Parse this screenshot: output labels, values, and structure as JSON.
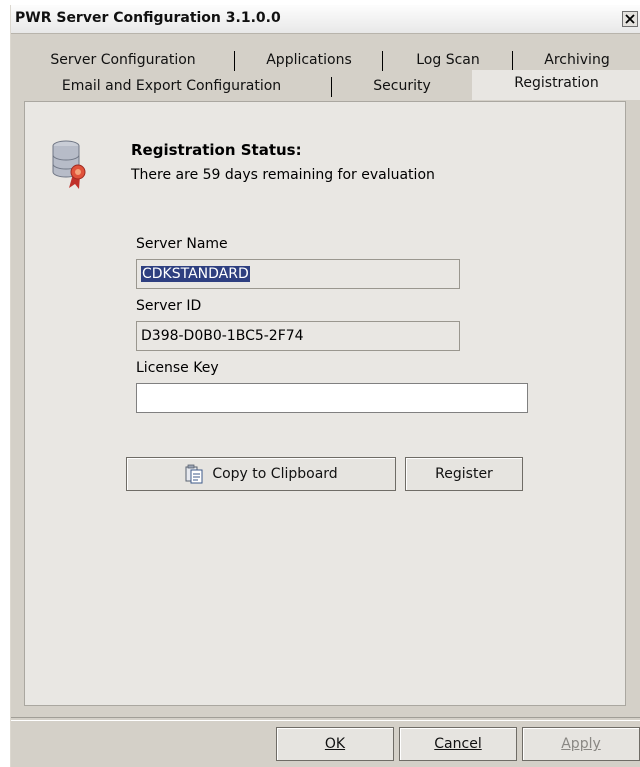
{
  "window": {
    "title": "PWR Server Configuration 3.1.0.0",
    "close_label": "X"
  },
  "tabs": {
    "row1": [
      "Server Configuration",
      "Applications",
      "Log Scan",
      "Archiving"
    ],
    "row2": [
      "Email and Export Configuration",
      "Security",
      "Registration"
    ],
    "active": "Registration"
  },
  "registration": {
    "status_title": "Registration Status:",
    "status_text": "There are 59 days remaining for evaluation",
    "server_name_label": "Server Name",
    "server_name_value": "CDKSTANDARD",
    "server_id_label": "Server ID",
    "server_id_value": "D398-D0B0-1BC5-2F74",
    "license_key_label": "License Key",
    "license_key_value": "",
    "copy_button": "Copy to Clipboard",
    "register_button": "Register"
  },
  "footer": {
    "ok": "OK",
    "cancel": "Cancel",
    "apply": "Apply"
  },
  "icons": {
    "status": "database-certificate-icon",
    "copy": "clipboard-icon",
    "close": "close-icon"
  },
  "colors": {
    "selection": "#2e3f80",
    "panel": "#e9e7e3",
    "dialog": "#d4d0c8"
  }
}
